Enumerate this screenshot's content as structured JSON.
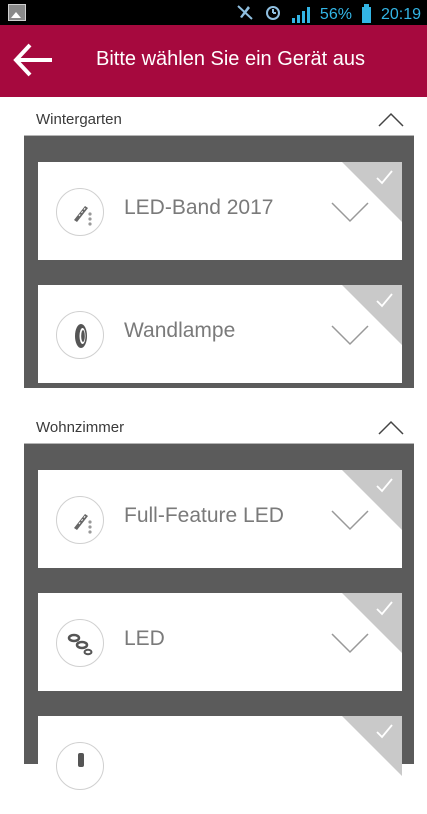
{
  "status_bar": {
    "battery": "56%",
    "time": "20:19"
  },
  "header": {
    "title": "Bitte wählen Sie ein Gerät aus"
  },
  "sections": [
    {
      "title": "Wintergarten",
      "devices": [
        {
          "label": "LED-Band 2017",
          "icon": "led-strip-icon"
        },
        {
          "label": "Wandlampe",
          "icon": "wall-lamp-icon"
        }
      ]
    },
    {
      "title": "Wohnzimmer",
      "devices": [
        {
          "label": "Full-Feature LED",
          "icon": "led-strip-icon"
        },
        {
          "label": "LED",
          "icon": "led-spots-icon"
        },
        {
          "label": "",
          "icon": "lamp-icon"
        }
      ]
    }
  ],
  "colors": {
    "header": "#a6093e",
    "section_body": "#5b5b5b",
    "corner": "#c9c9c9",
    "status_accent": "#33b5e5"
  }
}
